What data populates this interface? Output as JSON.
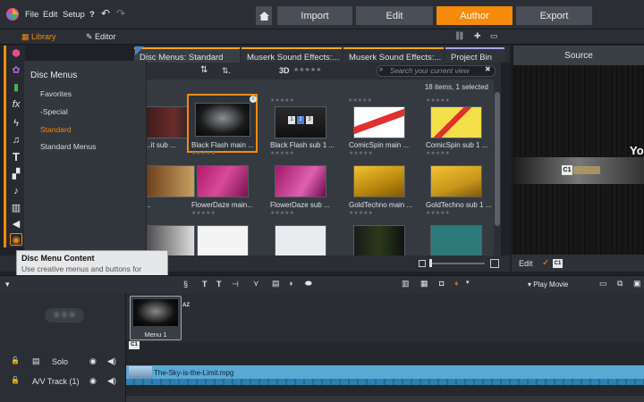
{
  "menubar": {
    "file": "File",
    "edit": "Edit",
    "setup": "Setup",
    "help": "?"
  },
  "nav": {
    "import": "Import",
    "edit": "Edit",
    "author": "Author",
    "export": "Export"
  },
  "subbar": {
    "library": "Library",
    "editor": "Editor"
  },
  "flyout": {
    "heading": "Disc Menus",
    "items": [
      "Favorites",
      "-Special",
      "Standard",
      "Standard Menus"
    ]
  },
  "tabs": [
    "Disc Menus: Standard",
    "Muserk Sound Effects:...",
    "Muserk Sound Effects:...",
    "Project Bin"
  ],
  "library": {
    "view_3d": "3D",
    "search_placeholder": "Search your current view",
    "count": "18 items, 1 selected",
    "items": [
      {
        "label": "...it sub ..."
      },
      {
        "label": "Black Flash main ..."
      },
      {
        "label": "Black Flash sub 1 ..."
      },
      {
        "label": "ComicSpin main ..."
      },
      {
        "label": "ComicSpin sub 1 ..."
      },
      {
        "label": "..."
      },
      {
        "label": "FlowerDaze main..."
      },
      {
        "label": "FlowerDaze sub ..."
      },
      {
        "label": "GoldTechno main ..."
      },
      {
        "label": "GoldTechno sub 1 ..."
      }
    ]
  },
  "source": {
    "title": "Source",
    "edit": "Edit",
    "c1": "C1",
    "yo": "Yo"
  },
  "tooltip": {
    "title": "Disc Menu Content",
    "body": "Use creative menus and buttons for making your Disc."
  },
  "timeline": {
    "play_movie": "Play Movie",
    "clip_label": "Menu 1",
    "az": "AZ",
    "c1": "C1",
    "solo": "Solo",
    "track": "A/V Track (1)",
    "video_clip": "The-Sky-is-the-Limit.mpg"
  },
  "colors": {
    "accent": "#f58a0b",
    "tab_border": "#a7a4e3",
    "selected": "#f58a0b"
  }
}
